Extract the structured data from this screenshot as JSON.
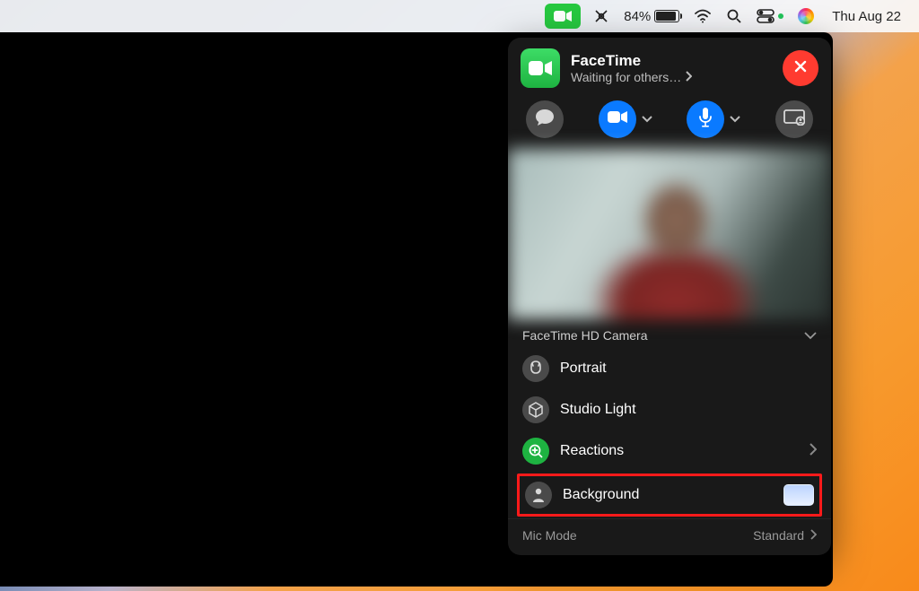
{
  "menubar": {
    "battery_pct": "84%",
    "date": "Thu Aug 22"
  },
  "popover": {
    "app_title": "FaceTime",
    "status": "Waiting for others…",
    "camera_label": "FaceTime HD Camera",
    "rows": {
      "portrait": "Portrait",
      "studio": "Studio Light",
      "reactions": "Reactions",
      "background": "Background"
    },
    "mic_mode_label": "Mic Mode",
    "mic_mode_value": "Standard"
  }
}
